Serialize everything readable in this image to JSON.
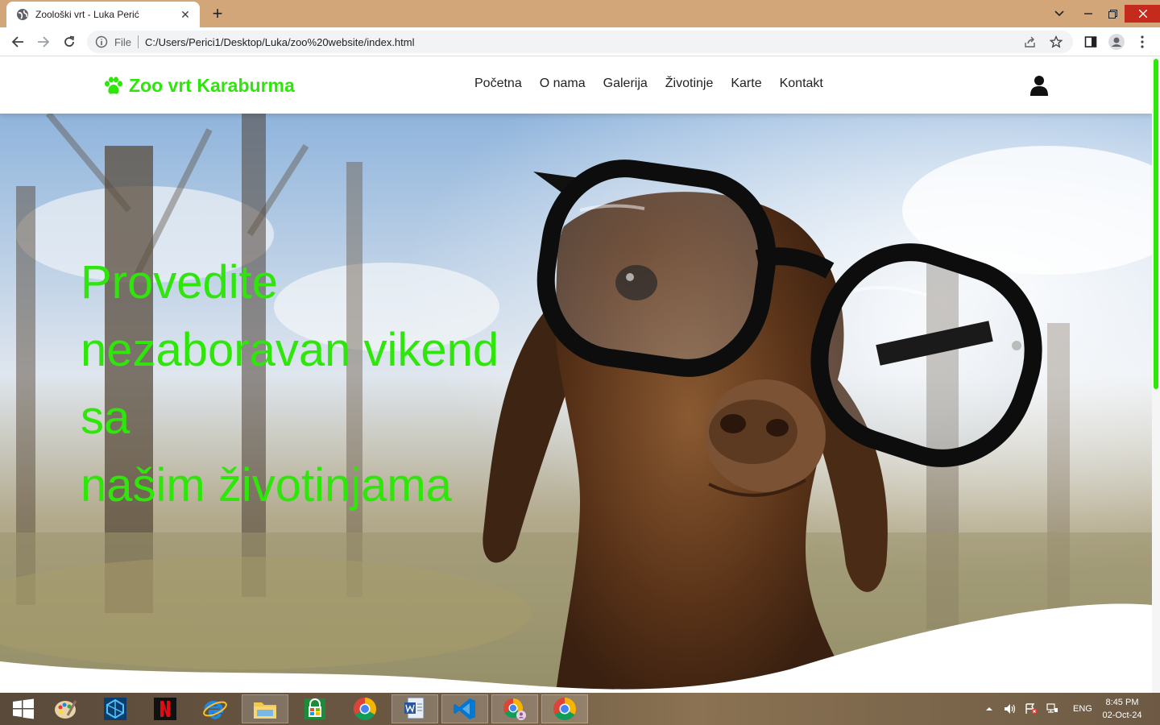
{
  "browser": {
    "tab_title": "Zoološki vrt - Luka Perić",
    "tab_close": "✕",
    "new_tab": "+",
    "omnibox_scheme": "File",
    "url": "C:/Users/Perici1/Desktop/Luka/zoo%20website/index.html"
  },
  "site": {
    "logo_text": "Zoo vrt Karaburma",
    "nav": [
      "Početna",
      "O nama",
      "Galerija",
      "Životinje",
      "Karte",
      "Kontakt"
    ],
    "hero_lines": [
      "Provedite",
      "nezaboravan vikend",
      "sa",
      "našim životinjama"
    ]
  },
  "taskbar": {
    "language": "ENG",
    "time": "8:45 PM",
    "date": "02-Oct-24"
  },
  "colors": {
    "accent": "#2ee60a",
    "titlebar": "#d2a679",
    "close": "#c42b1c"
  }
}
